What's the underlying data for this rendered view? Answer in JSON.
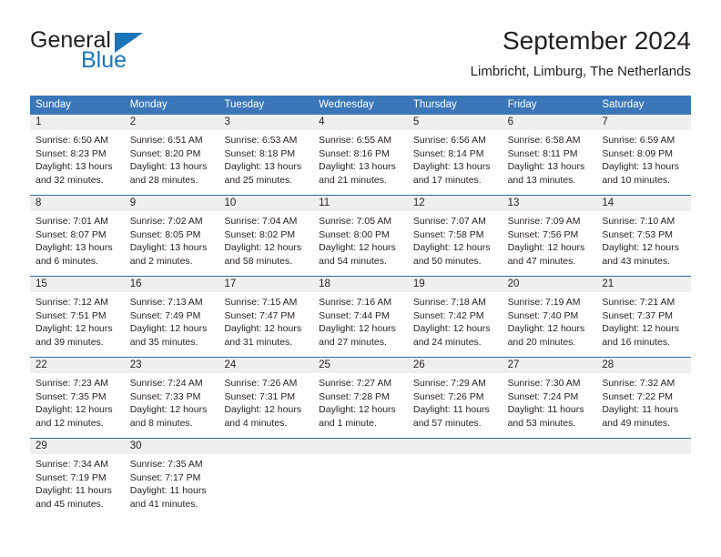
{
  "brand": {
    "name_top": "General",
    "name_bottom": "Blue",
    "accent_color": "#1b75bb"
  },
  "header": {
    "title": "September 2024",
    "subtitle": "Limbricht, Limburg, The Netherlands"
  },
  "theme": {
    "header_blue": "#3a76b8",
    "rule_blue": "#2e6da4",
    "day_band_gray": "#efefef",
    "text": "#231f20"
  },
  "weekdays": [
    "Sunday",
    "Monday",
    "Tuesday",
    "Wednesday",
    "Thursday",
    "Friday",
    "Saturday"
  ],
  "weeks": [
    [
      {
        "day": "1",
        "lines": [
          "Sunrise: 6:50 AM",
          "Sunset: 8:23 PM",
          "Daylight: 13 hours",
          "and 32 minutes."
        ]
      },
      {
        "day": "2",
        "lines": [
          "Sunrise: 6:51 AM",
          "Sunset: 8:20 PM",
          "Daylight: 13 hours",
          "and 28 minutes."
        ]
      },
      {
        "day": "3",
        "lines": [
          "Sunrise: 6:53 AM",
          "Sunset: 8:18 PM",
          "Daylight: 13 hours",
          "and 25 minutes."
        ]
      },
      {
        "day": "4",
        "lines": [
          "Sunrise: 6:55 AM",
          "Sunset: 8:16 PM",
          "Daylight: 13 hours",
          "and 21 minutes."
        ]
      },
      {
        "day": "5",
        "lines": [
          "Sunrise: 6:56 AM",
          "Sunset: 8:14 PM",
          "Daylight: 13 hours",
          "and 17 minutes."
        ]
      },
      {
        "day": "6",
        "lines": [
          "Sunrise: 6:58 AM",
          "Sunset: 8:11 PM",
          "Daylight: 13 hours",
          "and 13 minutes."
        ]
      },
      {
        "day": "7",
        "lines": [
          "Sunrise: 6:59 AM",
          "Sunset: 8:09 PM",
          "Daylight: 13 hours",
          "and 10 minutes."
        ]
      }
    ],
    [
      {
        "day": "8",
        "lines": [
          "Sunrise: 7:01 AM",
          "Sunset: 8:07 PM",
          "Daylight: 13 hours",
          "and 6 minutes."
        ]
      },
      {
        "day": "9",
        "lines": [
          "Sunrise: 7:02 AM",
          "Sunset: 8:05 PM",
          "Daylight: 13 hours",
          "and 2 minutes."
        ]
      },
      {
        "day": "10",
        "lines": [
          "Sunrise: 7:04 AM",
          "Sunset: 8:02 PM",
          "Daylight: 12 hours",
          "and 58 minutes."
        ]
      },
      {
        "day": "11",
        "lines": [
          "Sunrise: 7:05 AM",
          "Sunset: 8:00 PM",
          "Daylight: 12 hours",
          "and 54 minutes."
        ]
      },
      {
        "day": "12",
        "lines": [
          "Sunrise: 7:07 AM",
          "Sunset: 7:58 PM",
          "Daylight: 12 hours",
          "and 50 minutes."
        ]
      },
      {
        "day": "13",
        "lines": [
          "Sunrise: 7:09 AM",
          "Sunset: 7:56 PM",
          "Daylight: 12 hours",
          "and 47 minutes."
        ]
      },
      {
        "day": "14",
        "lines": [
          "Sunrise: 7:10 AM",
          "Sunset: 7:53 PM",
          "Daylight: 12 hours",
          "and 43 minutes."
        ]
      }
    ],
    [
      {
        "day": "15",
        "lines": [
          "Sunrise: 7:12 AM",
          "Sunset: 7:51 PM",
          "Daylight: 12 hours",
          "and 39 minutes."
        ]
      },
      {
        "day": "16",
        "lines": [
          "Sunrise: 7:13 AM",
          "Sunset: 7:49 PM",
          "Daylight: 12 hours",
          "and 35 minutes."
        ]
      },
      {
        "day": "17",
        "lines": [
          "Sunrise: 7:15 AM",
          "Sunset: 7:47 PM",
          "Daylight: 12 hours",
          "and 31 minutes."
        ]
      },
      {
        "day": "18",
        "lines": [
          "Sunrise: 7:16 AM",
          "Sunset: 7:44 PM",
          "Daylight: 12 hours",
          "and 27 minutes."
        ]
      },
      {
        "day": "19",
        "lines": [
          "Sunrise: 7:18 AM",
          "Sunset: 7:42 PM",
          "Daylight: 12 hours",
          "and 24 minutes."
        ]
      },
      {
        "day": "20",
        "lines": [
          "Sunrise: 7:19 AM",
          "Sunset: 7:40 PM",
          "Daylight: 12 hours",
          "and 20 minutes."
        ]
      },
      {
        "day": "21",
        "lines": [
          "Sunrise: 7:21 AM",
          "Sunset: 7:37 PM",
          "Daylight: 12 hours",
          "and 16 minutes."
        ]
      }
    ],
    [
      {
        "day": "22",
        "lines": [
          "Sunrise: 7:23 AM",
          "Sunset: 7:35 PM",
          "Daylight: 12 hours",
          "and 12 minutes."
        ]
      },
      {
        "day": "23",
        "lines": [
          "Sunrise: 7:24 AM",
          "Sunset: 7:33 PM",
          "Daylight: 12 hours",
          "and 8 minutes."
        ]
      },
      {
        "day": "24",
        "lines": [
          "Sunrise: 7:26 AM",
          "Sunset: 7:31 PM",
          "Daylight: 12 hours",
          "and 4 minutes."
        ]
      },
      {
        "day": "25",
        "lines": [
          "Sunrise: 7:27 AM",
          "Sunset: 7:28 PM",
          "Daylight: 12 hours",
          "and 1 minute."
        ]
      },
      {
        "day": "26",
        "lines": [
          "Sunrise: 7:29 AM",
          "Sunset: 7:26 PM",
          "Daylight: 11 hours",
          "and 57 minutes."
        ]
      },
      {
        "day": "27",
        "lines": [
          "Sunrise: 7:30 AM",
          "Sunset: 7:24 PM",
          "Daylight: 11 hours",
          "and 53 minutes."
        ]
      },
      {
        "day": "28",
        "lines": [
          "Sunrise: 7:32 AM",
          "Sunset: 7:22 PM",
          "Daylight: 11 hours",
          "and 49 minutes."
        ]
      }
    ],
    [
      {
        "day": "29",
        "lines": [
          "Sunrise: 7:34 AM",
          "Sunset: 7:19 PM",
          "Daylight: 11 hours",
          "and 45 minutes."
        ]
      },
      {
        "day": "30",
        "lines": [
          "Sunrise: 7:35 AM",
          "Sunset: 7:17 PM",
          "Daylight: 11 hours",
          "and 41 minutes."
        ]
      },
      {
        "day": "",
        "lines": []
      },
      {
        "day": "",
        "lines": []
      },
      {
        "day": "",
        "lines": []
      },
      {
        "day": "",
        "lines": []
      },
      {
        "day": "",
        "lines": []
      }
    ]
  ]
}
